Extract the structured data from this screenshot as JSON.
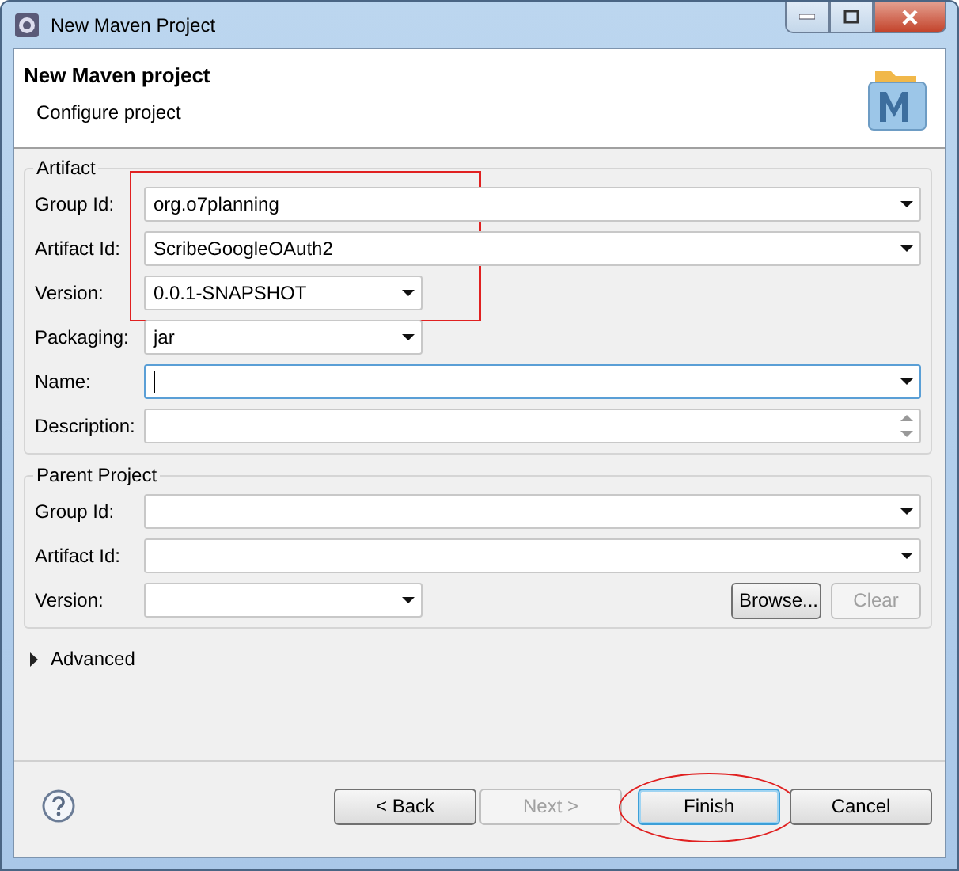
{
  "window": {
    "title": "New Maven Project"
  },
  "header": {
    "title": "New Maven project",
    "subtitle": "Configure project"
  },
  "artifact": {
    "title": "Artifact",
    "highlighted_fields": [
      {
        "label": "Group Id:",
        "value": "org.o7planning",
        "kind": "combo",
        "focused": false
      },
      {
        "label": "Artifact Id:",
        "value": "ScribeGoogleOAuth2",
        "kind": "combo",
        "focused": false
      },
      {
        "label": "Version:",
        "value": "0.0.1-SNAPSHOT",
        "kind": "short-combo",
        "focused": false
      }
    ],
    "fields": [
      {
        "label": "Packaging:",
        "value": "jar",
        "kind": "short-combo",
        "focused": false
      },
      {
        "label": "Name:",
        "kind": "combo",
        "focused": true
      },
      {
        "label": "Description:",
        "kind": "textarea",
        "focused": false
      }
    ]
  },
  "parent": {
    "title": "Parent Project",
    "fields": [
      {
        "label": "Group Id:",
        "kind": "combo"
      },
      {
        "label": "Artifact Id:",
        "kind": "combo"
      },
      {
        "label": "Version:",
        "kind": "short-combo"
      }
    ],
    "buttons": [
      {
        "label": "Browse...",
        "disabled": false
      },
      {
        "label": "Clear",
        "disabled": true
      }
    ]
  },
  "advanced": {
    "label": "Advanced",
    "expanded": false
  },
  "buttons": [
    {
      "label": "< Back",
      "disabled": false,
      "default": false,
      "circled": false
    },
    {
      "label": "Next >",
      "disabled": true,
      "default": false,
      "circled": false
    },
    {
      "label": "Finish",
      "disabled": false,
      "default": true,
      "circled": true
    },
    {
      "label": "Cancel",
      "disabled": false,
      "default": false,
      "circled": false
    }
  ]
}
